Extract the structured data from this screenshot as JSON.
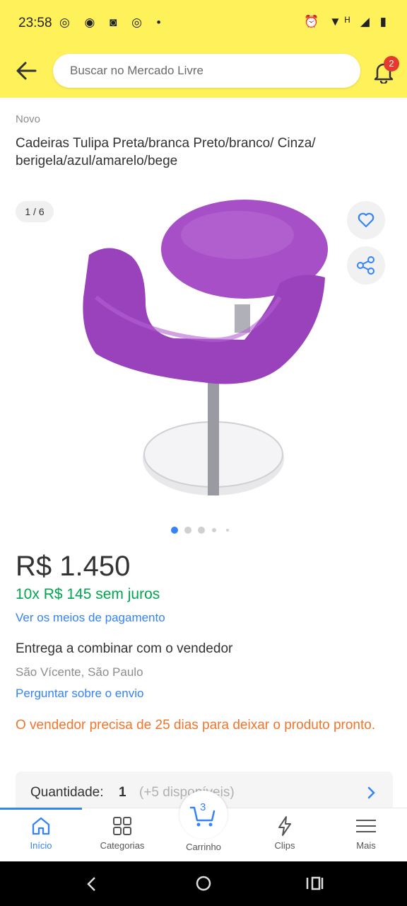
{
  "status_bar": {
    "time": "23:58",
    "left_icons": "◎ ◉ ◙ ◎ •",
    "right_icons": "⏰ ▼ᴴ ◢ ▮"
  },
  "header": {
    "search_placeholder": "Buscar no Mercado Livre",
    "notifications_count": "2"
  },
  "product": {
    "condition": "Novo",
    "title": "Cadeiras Tulipa Preta/branca Preto/branco/ Cinza/ berigela/azul/amarelo/bege",
    "image_counter": "1 / 6",
    "price": "R$ 1.450",
    "installments": "10x R$ 145  sem juros",
    "payment_link": "Ver os meios de pagamento",
    "shipping": "Entrega a combinar com o vendedor",
    "location": "São Vícente, São Paulo",
    "ask_shipping_link": "Perguntar sobre o envio",
    "warning": "O vendedor precisa de 25 dias para deixar o produto pronto.",
    "quantity_label": "Quantidade:",
    "quantity_value": "1",
    "quantity_available": "(+5 disponíveis)"
  },
  "tabs": [
    {
      "label": "Início"
    },
    {
      "label": "Categorias"
    },
    {
      "label": "Carrinho",
      "count": "3"
    },
    {
      "label": "Clips"
    },
    {
      "label": "Mais"
    }
  ],
  "colors": {
    "accent": "#3483fa",
    "brand_yellow": "#fff159",
    "green": "#00a650",
    "orange": "#f0762d"
  }
}
